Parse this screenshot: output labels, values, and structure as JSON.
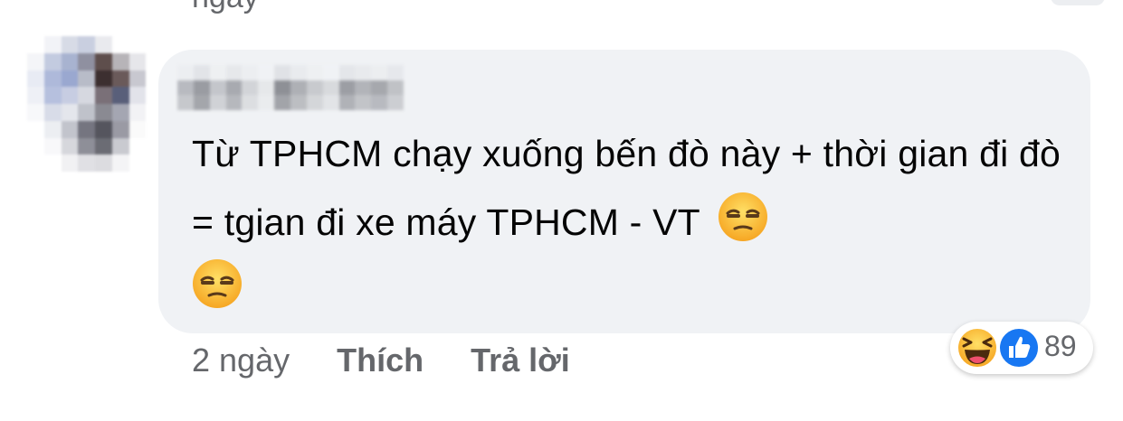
{
  "previous_comment": {
    "time_cutoff": "ngày"
  },
  "comment": {
    "text": "Từ TPHCM chạy xuống bến đò này + thời gian đi đò = tgian đi xe máy TPHCM - VT",
    "emojis": [
      "unamused-face-icon",
      "unamused-face-icon"
    ],
    "actions": {
      "time": "2 ngày",
      "like_label": "Thích",
      "reply_label": "Trả lời"
    },
    "reactions": {
      "icons": [
        "haha-reaction-icon",
        "like-reaction-icon"
      ],
      "count": "89"
    }
  },
  "colors": {
    "bubble_bg": "#f0f2f5",
    "text": "#050505",
    "secondary_text": "#65676b",
    "like_blue": "#1877f2",
    "emoji_yellow": "#fbc02d"
  }
}
